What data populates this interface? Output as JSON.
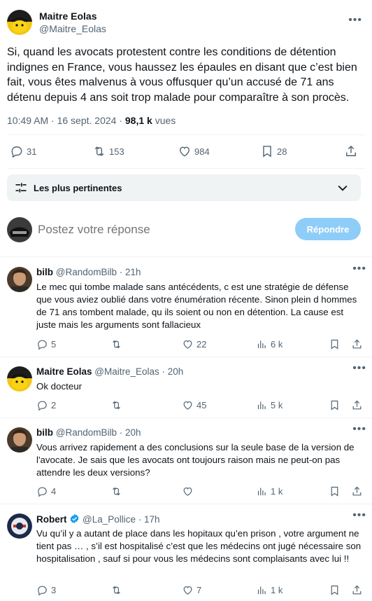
{
  "main_tweet": {
    "author_name": "Maitre Eolas",
    "author_handle": "@Maitre_Eolas",
    "text": "Si, quand les avocats protestent contre les conditions de détention indignes en France, vous haussez les épaules en disant que c’est bien fait, vous êtes malvenus à vous offusquer qu’un accusé de 71 ans détenu depuis 4 ans soit trop malade pour comparaître à son procès.",
    "time": "10:49 AM · 16 sept. 2024 · ",
    "views_count": "98,1 k",
    "views_label": " vues",
    "replies": "31",
    "reposts": "153",
    "likes": "984",
    "bookmarks": "28"
  },
  "sort": {
    "label": "Les plus pertinentes"
  },
  "compose": {
    "placeholder": "Postez votre réponse",
    "button": "Répondre"
  },
  "replies": [
    {
      "name": "bilb",
      "handle": "@RandomBilb",
      "time": " · 21h",
      "text": "Le mec qui tombe malade sans antécédents, c est une stratégie de défense que vous aviez oublié dans votre énumération récente. Sinon plein d hommes de 71 ans tombent malade, qu ils soient ou non en détention. La cause est juste mais les arguments sont fallacieux",
      "replies": "5",
      "reposts": "",
      "likes": "22",
      "views": "6 k"
    },
    {
      "name": "Maitre Eolas",
      "handle": "@Maitre_Eolas",
      "time": " · 20h",
      "text": "Ok docteur",
      "replies": "2",
      "reposts": "",
      "likes": "45",
      "views": "5 k"
    },
    {
      "name": "bilb",
      "handle": "@RandomBilb",
      "time": " · 20h",
      "text": "Vous arrivez rapidement a des conclusions sur la seule base de la version de l'avocate. Je sais que les avocats ont toujours raison mais ne peut-on pas attendre les deux versions?",
      "replies": "4",
      "reposts": "",
      "likes": "",
      "views": "1 k"
    },
    {
      "name": "Robert",
      "handle": "@La_Pollice",
      "time": " · 17h",
      "text": "Vu qu’il y a autant de place dans les hopitaux qu’en prison , votre argument ne tient pas … , s’il est hospitalisé c’est que les médecins ont jugé nécessaire son hospitalisation , sauf si pour vous les médecins sont complaisants avec lui !!",
      "replies": "3",
      "reposts": "",
      "likes": "7",
      "views": "1 k"
    }
  ],
  "colors": {
    "accent": "#1d9bf0",
    "reply_button_disabled": "#8ecdf8",
    "muted": "#536471"
  }
}
